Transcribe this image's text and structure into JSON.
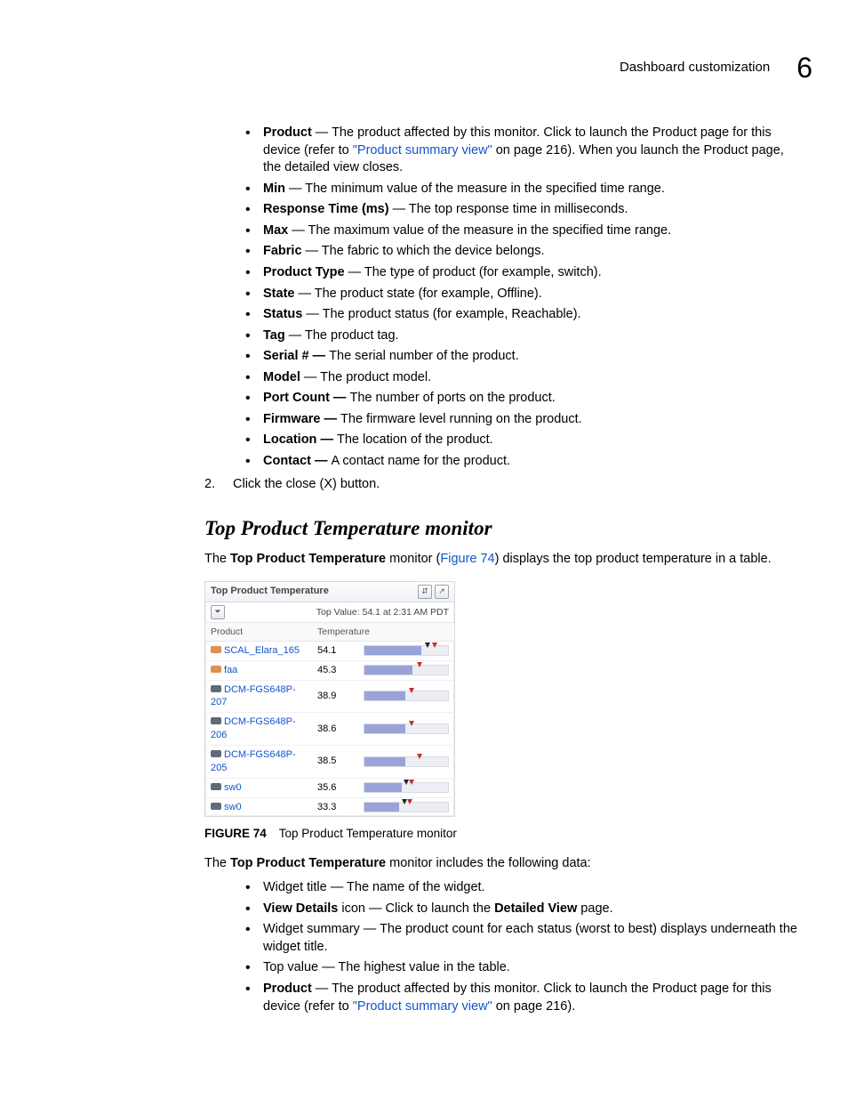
{
  "header": {
    "title": "Dashboard customization",
    "chapter_number": "6"
  },
  "definitions1": [
    {
      "term": "Product",
      "desc_a": " — The product affected by this monitor. Click to launch the Product page for this device (refer to ",
      "link": "\"Product summary view\"",
      "desc_b": " on page 216). When you launch the Product page, the detailed view closes."
    },
    {
      "term": "Min",
      "desc_a": " — The minimum value of the measure in the specified time range."
    },
    {
      "term": "Response Time (ms)",
      "desc_a": " — The top response time in milliseconds."
    },
    {
      "term": "Max",
      "desc_a": " — The maximum value of the measure in the specified time range."
    },
    {
      "term": "Fabric",
      "desc_a": " — The fabric to which the device belongs."
    },
    {
      "term": "Product Type",
      "desc_a": " — The type of product (for example, switch)."
    },
    {
      "term": "State",
      "desc_a": " — The product state (for example, Offline)."
    },
    {
      "term": "Status",
      "desc_a": " — The product status (for example, Reachable)."
    },
    {
      "term": "Tag",
      "desc_a": " — The product tag."
    },
    {
      "term": "Serial # — ",
      "desc_a": "The serial number of the product."
    },
    {
      "term": "Model",
      "desc_a": " — The product model."
    },
    {
      "term": "Port Count — ",
      "desc_a": "The number of ports on the product."
    },
    {
      "term": "Firmware — ",
      "desc_a": "The firmware level running on the product."
    },
    {
      "term": "Location — ",
      "desc_a": "The location of the product."
    },
    {
      "term": "Contact — ",
      "desc_a": "A contact name for the product."
    }
  ],
  "step2": {
    "num": "2.",
    "text": "Click the close (X) button."
  },
  "section": {
    "heading": "Top Product Temperature monitor"
  },
  "para1": {
    "a": "The ",
    "bold1": "Top Product Temperature",
    "b": " monitor (",
    "figref": "Figure 74",
    "c": ") displays the top product temperature in a table."
  },
  "widget": {
    "title": "Top Product Temperature",
    "topvalue": "Top Value: 54.1 at 2:31 AM PDT",
    "columns": {
      "product": "Product",
      "temperature": "Temperature"
    },
    "rows": [
      {
        "name": "SCAL_Elara_165",
        "icon": "orange",
        "temp": "54.1",
        "fill": 68,
        "marks": [
          76,
          84
        ]
      },
      {
        "name": "faa",
        "icon": "orange",
        "temp": "45.3",
        "fill": 57,
        "marks": [
          66
        ]
      },
      {
        "name": "DCM-FGS648P-207",
        "icon": "gray",
        "temp": "38.9",
        "fill": 49,
        "marks": [
          56
        ]
      },
      {
        "name": "DCM-FGS648P-206",
        "icon": "gray",
        "temp": "38.6",
        "fill": 49,
        "marks": [
          56
        ]
      },
      {
        "name": "DCM-FGS648P-205",
        "icon": "gray",
        "temp": "38.5",
        "fill": 49,
        "marks": [
          66
        ]
      },
      {
        "name": "sw0",
        "icon": "gray",
        "temp": "35.6",
        "fill": 45,
        "marks": [
          50,
          56
        ]
      },
      {
        "name": "sw0",
        "icon": "gray",
        "temp": "33.3",
        "fill": 42,
        "marks": [
          48,
          54
        ]
      }
    ]
  },
  "figure": {
    "num": "FIGURE 74",
    "caption": "Top Product Temperature monitor"
  },
  "para2": {
    "a": "The ",
    "bold": "Top Product Temperature",
    "b": " monitor includes the following data:"
  },
  "definitions2": [
    {
      "plain_a": "Widget title — The name of the widget."
    },
    {
      "term": "View Details",
      "desc_a": " icon — Click to launch the ",
      "term2": "Detailed View",
      "desc_b": " page."
    },
    {
      "plain_a": "Widget summary — The product count for each status (worst to best) displays underneath the widget title."
    },
    {
      "plain_a": "Top value — The highest value in the table."
    },
    {
      "term": "Product",
      "desc_a": " — The product affected by this monitor. Click to launch the Product page for this device (refer to ",
      "link": "\"Product summary view\"",
      "desc_b": " on page 216)."
    }
  ]
}
